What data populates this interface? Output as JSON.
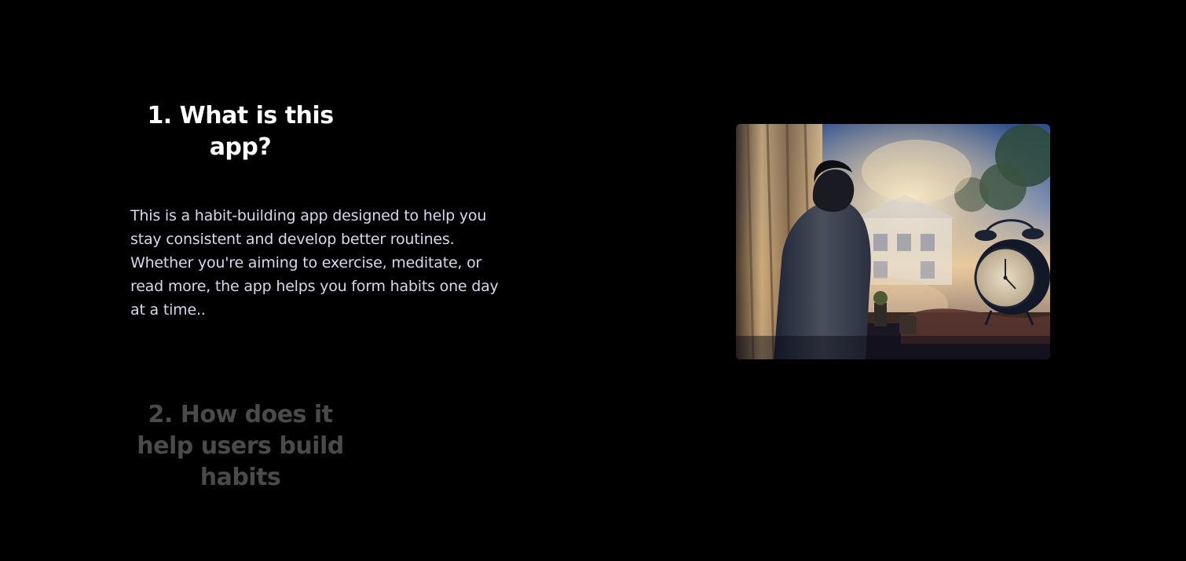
{
  "faq": {
    "items": [
      {
        "question": "1. What is this app?",
        "answer": "This is a habit-building app designed to help you stay consistent and develop better routines. Whether you're aiming to exercise, meditate, or read more, the app helps you form habits one day at a time..",
        "expanded": true
      },
      {
        "question": "2. How does it help users build habits",
        "expanded": false
      }
    ]
  },
  "image": {
    "alt": "Person in hoodie at a sunlit window beside an alarm clock"
  },
  "colors": {
    "background": "#000000",
    "active_title": "#ffffff",
    "inactive_title": "#4a4a4a",
    "body_text": "#d8d8ec"
  }
}
